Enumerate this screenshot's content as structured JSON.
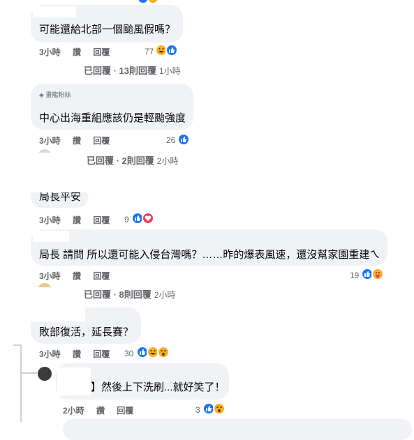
{
  "comments": [
    {
      "text": "可能還給北部一個颱風假嗎？",
      "time": "3小時",
      "like": "讚",
      "reply": "回覆",
      "count": "77"
    },
    {
      "badge": "畫龍粉絲",
      "text": "中心出海重組應該仍是輕颱強度",
      "time": "3小時",
      "like": "讚",
      "reply": "回覆",
      "count": "26"
    },
    {
      "text": "局長平安",
      "time": "3小時",
      "like": "讚",
      "reply": "回覆",
      "count": "9"
    },
    {
      "text": "局長 請問 所以還可能入侵台灣嗎？……昨的爆表風速，還沒幫家園重建ㄟ",
      "time": "3小時",
      "like": "讚",
      "reply": "回覆",
      "count": "19"
    },
    {
      "text": "敗部復活，延長賽？",
      "time": "3小時",
      "like": "讚",
      "reply": "回覆",
      "count": "30"
    },
    {
      "text": "】然後上下洗刷...就好笑了！",
      "time": "2小時",
      "like": "讚",
      "reply": "回覆",
      "count": "3"
    }
  ],
  "reply_summaries": [
    {
      "label": "已回覆 · 13則回覆",
      "time": "1小時"
    },
    {
      "label": "已回覆 · 2則回覆",
      "time": "2小時"
    },
    {
      "label": "已回覆 · 8則回覆",
      "time": "2小時"
    }
  ],
  "colors": {
    "like": "#1877f2",
    "love": "#f33e58",
    "haha": "#f7b125",
    "muted": "#65676b",
    "bubble": "#f0f2f5"
  }
}
